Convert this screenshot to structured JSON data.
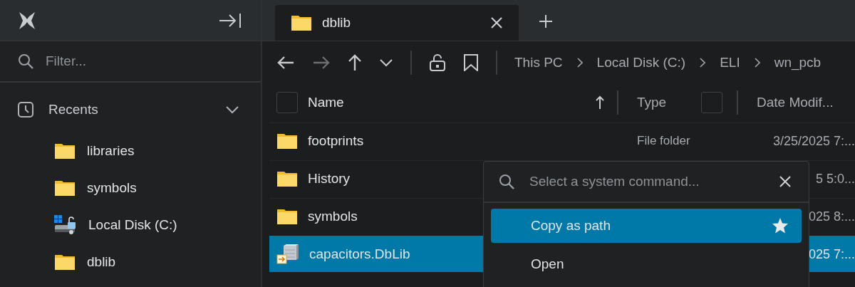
{
  "sidebar": {
    "filter": {
      "placeholder": "Filter..."
    },
    "section": {
      "label": "Recents",
      "expanded": true
    },
    "items": [
      {
        "label": "libraries",
        "kind": "folder"
      },
      {
        "label": "symbols",
        "kind": "folder"
      },
      {
        "label": "Local Disk (C:)",
        "kind": "drive"
      },
      {
        "label": "dblib",
        "kind": "folder"
      }
    ]
  },
  "tabs": [
    {
      "label": "dblib",
      "selected": true
    }
  ],
  "breadcrumb": [
    "This PC",
    "Local Disk (C:)",
    "ELI",
    "wn_pcb"
  ],
  "table": {
    "columns": [
      {
        "label": "Name",
        "checked": false,
        "sort_ascending": true
      },
      {
        "label": "Type",
        "checked": false
      },
      {
        "label": "Date Modif..."
      }
    ],
    "rows": [
      {
        "name": "footprints",
        "kind": "folder",
        "type": "File folder",
        "date": "3/25/2025 7:...",
        "selected": false
      },
      {
        "name": "History",
        "kind": "folder",
        "date": "5 5:0...",
        "selected": false
      },
      {
        "name": "symbols",
        "kind": "folder",
        "date": "025 8:...",
        "selected": false
      },
      {
        "name": "capacitors.DbLib",
        "kind": "dblib",
        "date": "025 7:...",
        "selected": true
      }
    ]
  },
  "command_palette": {
    "placeholder": "Select a system command...",
    "items": [
      {
        "label": "Copy as path",
        "selected": true,
        "favorite": true
      },
      {
        "label": "Open",
        "selected": false,
        "favorite": false
      }
    ]
  }
}
